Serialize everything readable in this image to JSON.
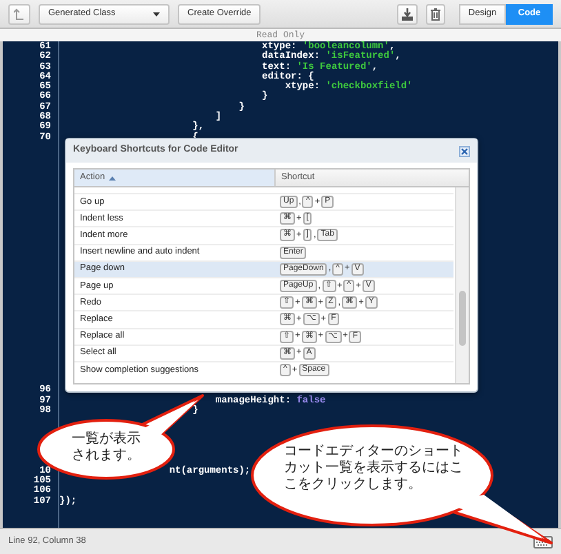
{
  "toolbar": {
    "class_select": {
      "value": "Generated Class"
    },
    "override_button": "Create Override",
    "view_toggle": [
      {
        "label": "Design",
        "selected": false
      },
      {
        "label": "Code",
        "selected": true
      }
    ]
  },
  "read_only_banner": "Read Only",
  "code_blocks": [
    [
      {
        "number": "61",
        "segments": [
          {
            "kind": "plain",
            "text": "                                   xtype: "
          },
          {
            "kind": "string",
            "text": "'booleancolumn'"
          },
          {
            "kind": "plain",
            "text": ","
          }
        ]
      },
      {
        "number": "62",
        "segments": [
          {
            "kind": "plain",
            "text": "                                   dataIndex: "
          },
          {
            "kind": "string",
            "text": "'isFeatured'"
          },
          {
            "kind": "plain",
            "text": ","
          }
        ]
      },
      {
        "number": "63",
        "segments": [
          {
            "kind": "plain",
            "text": "                                   text: "
          },
          {
            "kind": "string",
            "text": "'Is Featured'"
          },
          {
            "kind": "plain",
            "text": ","
          }
        ]
      },
      {
        "number": "64",
        "segments": [
          {
            "kind": "plain",
            "text": "                                   editor: {"
          }
        ]
      },
      {
        "number": "65",
        "segments": [
          {
            "kind": "plain",
            "text": "                                       xtype: "
          },
          {
            "kind": "string",
            "text": "'checkboxfield'"
          }
        ]
      },
      {
        "number": "66",
        "segments": [
          {
            "kind": "plain",
            "text": "                                   }"
          }
        ]
      },
      {
        "number": "67",
        "segments": [
          {
            "kind": "plain",
            "text": "                               }"
          }
        ]
      },
      {
        "number": "68",
        "segments": [
          {
            "kind": "plain",
            "text": "                           ]"
          }
        ]
      },
      {
        "number": "69",
        "segments": [
          {
            "kind": "plain",
            "text": "                       },"
          }
        ]
      },
      {
        "number": "70",
        "segments": [
          {
            "kind": "plain",
            "text": "                       {"
          }
        ]
      }
    ],
    [
      {
        "number": "96"
      },
      {
        "number": "97",
        "segments": [
          {
            "kind": "plain",
            "text": "                           manageHeight: "
          },
          {
            "kind": "keyword",
            "text": "false"
          }
        ]
      },
      {
        "number": "98",
        "segments": [
          {
            "kind": "plain",
            "text": "                       }"
          }
        ]
      }
    ],
    [
      {
        "number": "10",
        "segments": [
          {
            "kind": "plain",
            "text": "                   nt(arguments);"
          }
        ]
      },
      {
        "number": "105"
      },
      {
        "number": "106"
      },
      {
        "number": "107",
        "segments": [
          {
            "kind": "plain",
            "text": "});"
          }
        ]
      }
    ]
  ],
  "shortcuts_dialog": {
    "title": "Keyboard Shortcuts for Code Editor",
    "columns": [
      {
        "label": "Action",
        "sorted": true
      },
      {
        "label": "Shortcut"
      }
    ],
    "rows": [
      {
        "action": "Go up",
        "selected": false,
        "shortcut": [
          {
            "key": "Up"
          },
          {
            "sep": ","
          },
          {
            "key": "^"
          },
          {
            "sep": "+"
          },
          {
            "key": "P"
          }
        ]
      },
      {
        "action": "Indent less",
        "selected": false,
        "shortcut": [
          {
            "key": "⌘"
          },
          {
            "sep": "+"
          },
          {
            "key": "["
          }
        ]
      },
      {
        "action": "Indent more",
        "selected": false,
        "shortcut": [
          {
            "key": "⌘"
          },
          {
            "sep": "+"
          },
          {
            "key": "]"
          },
          {
            "sep": ","
          },
          {
            "key": "Tab"
          }
        ]
      },
      {
        "action": "Insert newline and auto indent",
        "selected": false,
        "shortcut": [
          {
            "key": "Enter"
          }
        ]
      },
      {
        "action": "Page down",
        "selected": true,
        "shortcut": [
          {
            "key": "PageDown"
          },
          {
            "sep": ","
          },
          {
            "key": "^"
          },
          {
            "sep": "+"
          },
          {
            "key": "V"
          }
        ]
      },
      {
        "action": "Page up",
        "selected": false,
        "shortcut": [
          {
            "key": "PageUp"
          },
          {
            "sep": ","
          },
          {
            "key": "⇧"
          },
          {
            "sep": "+"
          },
          {
            "key": "^"
          },
          {
            "sep": "+"
          },
          {
            "key": "V"
          }
        ]
      },
      {
        "action": "Redo",
        "selected": false,
        "shortcut": [
          {
            "key": "⇧"
          },
          {
            "sep": "+"
          },
          {
            "key": "⌘"
          },
          {
            "sep": "+"
          },
          {
            "key": "Z"
          },
          {
            "sep": ","
          },
          {
            "key": "⌘"
          },
          {
            "sep": "+"
          },
          {
            "key": "Y"
          }
        ]
      },
      {
        "action": "Replace",
        "selected": false,
        "shortcut": [
          {
            "key": "⌘"
          },
          {
            "sep": "+"
          },
          {
            "key": "⌥"
          },
          {
            "sep": "+"
          },
          {
            "key": "F"
          }
        ]
      },
      {
        "action": "Replace all",
        "selected": false,
        "shortcut": [
          {
            "key": "⇧"
          },
          {
            "sep": "+"
          },
          {
            "key": "⌘"
          },
          {
            "sep": "+"
          },
          {
            "key": "⌥"
          },
          {
            "sep": "+"
          },
          {
            "key": "F"
          }
        ]
      },
      {
        "action": "Select all",
        "selected": false,
        "shortcut": [
          {
            "key": "⌘"
          },
          {
            "sep": "+"
          },
          {
            "key": "A"
          }
        ]
      },
      {
        "action": "Show completion suggestions",
        "selected": false,
        "shortcut": [
          {
            "key": "^"
          },
          {
            "sep": "+"
          },
          {
            "key": "Space"
          }
        ]
      }
    ]
  },
  "callouts": [
    {
      "text": "一覧が表示されます。"
    },
    {
      "text": "コードエディターのショートカット一覧を表示するにはここをクリックします。"
    }
  ],
  "status_bar": {
    "position": "Line 92, Column 38"
  }
}
